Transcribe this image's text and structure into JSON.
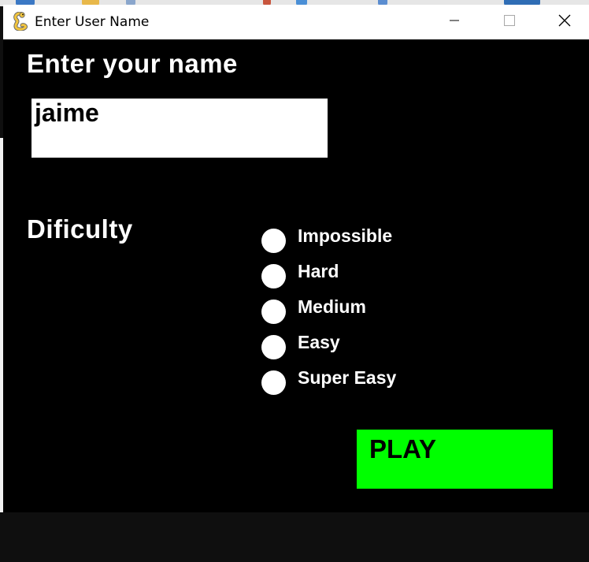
{
  "window": {
    "title": "Enter User Name",
    "icon": "pygame-snake-icon"
  },
  "controls": {
    "minimize_icon": "minimize-icon",
    "maximize_icon": "maximize-icon",
    "close_icon": "close-icon"
  },
  "form": {
    "name_heading": "Enter your name",
    "name_value": "jaime",
    "difficulty_heading": "Dificulty",
    "difficulty_options": [
      "Impossible",
      "Hard",
      "Medium",
      "Easy",
      "Super Easy"
    ],
    "play_label": "PLAY"
  },
  "colors": {
    "background": "#000000",
    "text": "#ffffff",
    "play_button": "#00ff00",
    "input_background": "#ffffff"
  }
}
